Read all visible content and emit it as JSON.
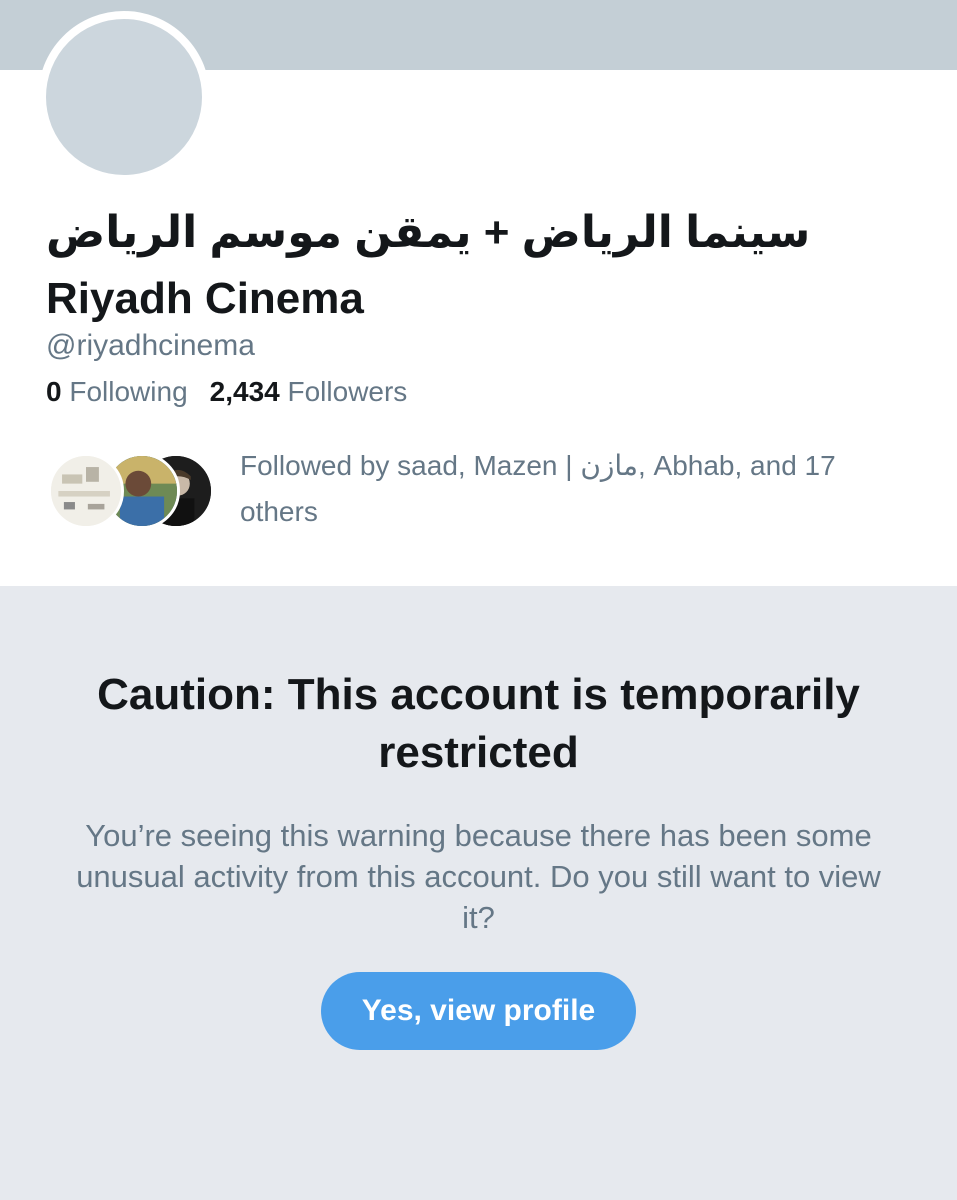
{
  "profile": {
    "name_arabic": "سينما الرياض + يمقن موسم الرياض",
    "name_latin": "Riyadh Cinema",
    "handle": "@riyadhcinema",
    "following_count": "0",
    "following_label": "Following",
    "followers_count": "2,434",
    "followers_label": "Followers",
    "followed_by": "Followed by saad, Mazen | مازن, Abhab, and 17 others"
  },
  "warning": {
    "title": "Caution: This account is temporarily restricted",
    "body": "You’re seeing this warning because there has been some unusual activity from this account. Do you still want to view it?",
    "button_label": "Yes, view profile"
  },
  "colors": {
    "banner": "#c4cfd6",
    "warning_background": "#e6e9ee",
    "button": "#4a9eea",
    "secondary_text": "#657786"
  }
}
